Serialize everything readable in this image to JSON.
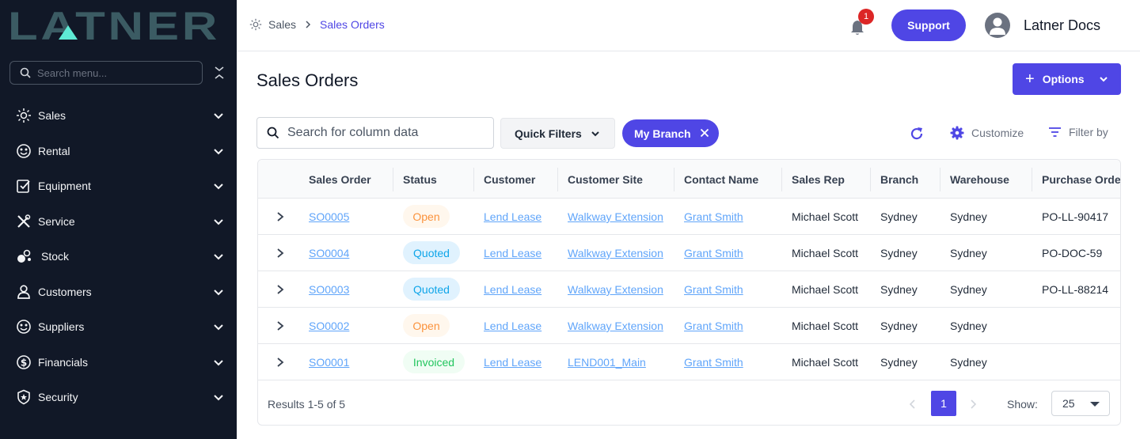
{
  "sidebar": {
    "logo_text": "LATNER",
    "search_placeholder": "Search menu...",
    "items": [
      {
        "label": "Sales",
        "icon": "sales-icon"
      },
      {
        "label": "Rental",
        "icon": "rental-icon"
      },
      {
        "label": "Equipment",
        "icon": "equipment-icon"
      },
      {
        "label": "Service",
        "icon": "service-icon"
      },
      {
        "label": "Stock",
        "icon": "stock-icon"
      },
      {
        "label": "Customers",
        "icon": "customers-icon"
      },
      {
        "label": "Suppliers",
        "icon": "suppliers-icon"
      },
      {
        "label": "Financials",
        "icon": "financials-icon"
      },
      {
        "label": "Security",
        "icon": "security-icon"
      }
    ]
  },
  "header": {
    "breadcrumb": [
      "Sales",
      "Sales Orders"
    ],
    "notification_count": "1",
    "support_label": "Support",
    "user_name": "Latner Docs"
  },
  "main": {
    "title": "Sales Orders",
    "options_label": "Options",
    "search_placeholder": "Search for column data",
    "quick_filters_label": "Quick Filters",
    "active_filter_chip": "My Branch",
    "customize_label": "Customize",
    "filter_by_label": "Filter by"
  },
  "table": {
    "columns": [
      "Sales Order",
      "Status",
      "Customer",
      "Customer Site",
      "Contact Name",
      "Sales Rep",
      "Branch",
      "Warehouse",
      "Purchase Orde"
    ],
    "rows": [
      {
        "order": "SO0005",
        "status": "Open",
        "customer": "Lend Lease",
        "site": "Walkway Extension",
        "contact": "Grant Smith",
        "rep": "Michael Scott",
        "branch": "Sydney",
        "warehouse": "Sydney",
        "po": "PO-LL-90417"
      },
      {
        "order": "SO0004",
        "status": "Quoted",
        "customer": "Lend Lease",
        "site": "Walkway Extension",
        "contact": "Grant Smith",
        "rep": "Michael Scott",
        "branch": "Sydney",
        "warehouse": "Sydney",
        "po": "PO-DOC-59"
      },
      {
        "order": "SO0003",
        "status": "Quoted",
        "customer": "Lend Lease",
        "site": "Walkway Extension",
        "contact": "Grant Smith",
        "rep": "Michael Scott",
        "branch": "Sydney",
        "warehouse": "Sydney",
        "po": "PO-LL-88214"
      },
      {
        "order": "SO0002",
        "status": "Open",
        "customer": "Lend Lease",
        "site": "Walkway Extension",
        "contact": "Grant Smith",
        "rep": "Michael Scott",
        "branch": "Sydney",
        "warehouse": "Sydney",
        "po": ""
      },
      {
        "order": "SO0001",
        "status": "Invoiced",
        "customer": "Lend Lease",
        "site": "LEND001_Main",
        "contact": "Grant Smith",
        "rep": "Michael Scott",
        "branch": "Sydney",
        "warehouse": "Sydney",
        "po": ""
      }
    ]
  },
  "footer": {
    "results_text": "Results 1-5 of 5",
    "current_page": "1",
    "show_label": "Show:",
    "page_size": "25"
  },
  "colors": {
    "sidebar_bg": "#111827",
    "accent": "#4f46e5",
    "logo": "#3b5b63",
    "logo_accent": "#5eead4",
    "link": "#60a5fa"
  }
}
